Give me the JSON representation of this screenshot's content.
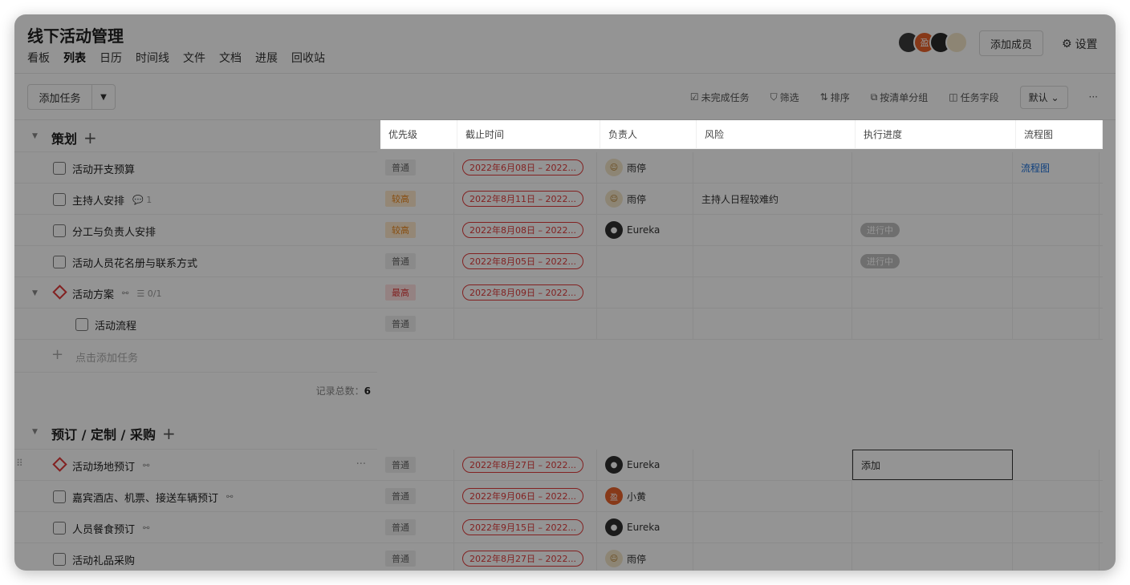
{
  "app": {
    "title": "线下活动管理",
    "nav": [
      "看板",
      "列表",
      "日历",
      "时间线",
      "文件",
      "文档",
      "进展",
      "回收站"
    ],
    "active_nav": "列表",
    "add_member_label": "添加成员",
    "settings_label": "设置"
  },
  "toolbar": {
    "add_task_label": "添加任务",
    "incomplete_label": "未完成任务",
    "filter_label": "筛选",
    "sort_label": "排序",
    "group_label": "按清单分组",
    "fields_label": "任务字段",
    "view_label": "默认",
    "more_label": "···"
  },
  "columns": [
    "优先级",
    "截止时间",
    "负责人",
    "风险",
    "执行进度",
    "流程图"
  ],
  "groups": [
    {
      "title": "策划",
      "record_label": "记录总数：",
      "record_count": "6",
      "add_task_placeholder": "点击添加任务",
      "tasks": [
        {
          "name": "活动开支预算",
          "priority": "普通",
          "date": "2022年6月08日 – 2022...",
          "assignee": "雨停",
          "risk": "",
          "progress": "",
          "flow": "流程图"
        },
        {
          "name": "主持人安排",
          "comment_count": "1",
          "priority": "较高",
          "date": "2022年8月11日 – 2022...",
          "assignee": "雨停",
          "risk": "主持人日程较难约",
          "progress": "",
          "flow": ""
        },
        {
          "name": "分工与负责人安排",
          "priority": "较高",
          "date": "2022年8月08日 – 2022...",
          "assignee": "Eureka",
          "risk": "",
          "progress": "进行中",
          "flow": ""
        },
        {
          "name": "活动人员花名册与联系方式",
          "priority": "普通",
          "date": "2022年8月05日 – 2022...",
          "assignee": "",
          "risk": "",
          "progress": "进行中",
          "flow": ""
        },
        {
          "name": "活动方案",
          "subtask_count": "0/1",
          "priority": "最高",
          "date": "2022年8月09日 – 2022...",
          "assignee": "",
          "risk": "",
          "progress": "",
          "flow": ""
        },
        {
          "name": "活动流程",
          "priority": "普通",
          "date": "",
          "assignee": "",
          "risk": "",
          "progress": "",
          "flow": ""
        }
      ]
    },
    {
      "title": "预订 / 定制 / 采购",
      "tasks": [
        {
          "name": "活动场地预订",
          "priority": "普通",
          "date": "2022年8月27日 – 2022...",
          "assignee": "Eureka",
          "risk": "",
          "progress": "添加",
          "flow": ""
        },
        {
          "name": "嘉宾酒店、机票、接送车辆预订",
          "priority": "普通",
          "date": "2022年9月06日 – 2022...",
          "assignee": "小黄",
          "risk": "",
          "progress": "",
          "flow": ""
        },
        {
          "name": "人员餐食预订",
          "priority": "普通",
          "date": "2022年9月15日 – 2022...",
          "assignee": "Eureka",
          "risk": "",
          "progress": "",
          "flow": ""
        },
        {
          "name": "活动礼品采购",
          "priority": "普通",
          "date": "2022年8月27日 – 2022...",
          "assignee": "雨停",
          "risk": "",
          "progress": "",
          "flow": ""
        }
      ]
    }
  ],
  "avatar_badge": "盈"
}
